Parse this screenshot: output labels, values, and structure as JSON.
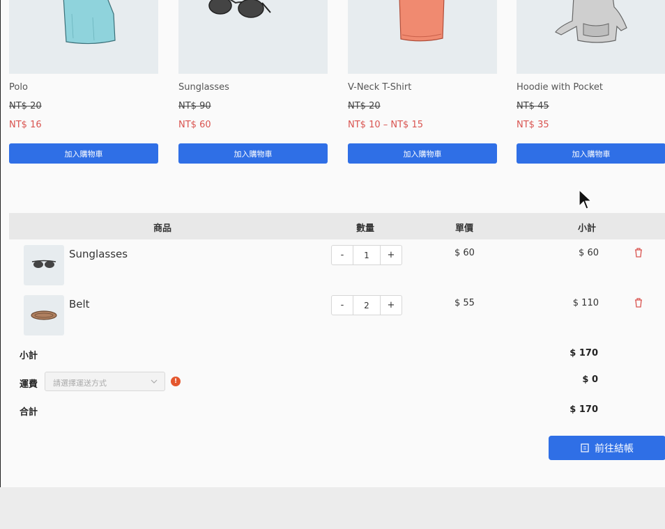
{
  "products": [
    {
      "name": "Polo",
      "old_price": "NT$ 20",
      "price": "NT$ 16",
      "button": "加入購物車",
      "shirt_color": "#8fd3dc"
    },
    {
      "name": "Sunglasses",
      "old_price": "NT$ 90",
      "price": "NT$ 60",
      "button": "加入購物車"
    },
    {
      "name": "V-Neck T-Shirt",
      "old_price": "NT$ 20",
      "price": "NT$ 10 – NT$ 15",
      "button": "加入購物車",
      "shirt_color": "#f08a70"
    },
    {
      "name": "Hoodie with Pocket",
      "old_price": "NT$ 45",
      "price": "NT$ 35",
      "button": "加入購物車",
      "shirt_color": "#c9c9c9"
    }
  ],
  "cart": {
    "headers": {
      "product": "商品",
      "quantity": "數量",
      "unit_price": "單價",
      "subtotal": "小計"
    },
    "items": [
      {
        "name": "Sunglasses",
        "qty": "1",
        "unit_price": "$ 60",
        "subtotal": "$ 60"
      },
      {
        "name": "Belt",
        "qty": "2",
        "unit_price": "$ 55",
        "subtotal": "$ 110"
      }
    ],
    "stepper": {
      "minus": "-",
      "plus": "+"
    },
    "summary": {
      "subtotal_label": "小計",
      "subtotal_value": "$ 170",
      "shipping_label": "運費",
      "shipping_placeholder": "請選擇運送方式",
      "shipping_value": "$ 0",
      "total_label": "合計",
      "total_value": "$ 170"
    },
    "info_badge": "!",
    "checkout_label": "前往結帳"
  },
  "colors": {
    "accent": "#2f6fe6",
    "sale": "#d9534f",
    "delete": "#d9534f",
    "info": "#e4572e"
  },
  "icons": {
    "delete": "trash-icon",
    "checkout": "receipt-icon",
    "select": "chevron-down-icon",
    "info": "info-icon"
  }
}
